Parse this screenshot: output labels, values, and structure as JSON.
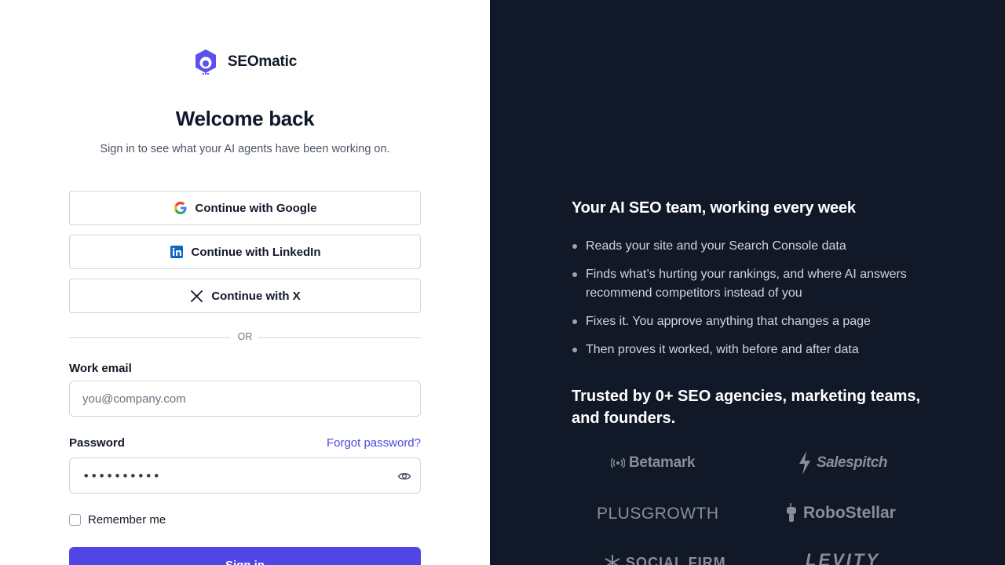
{
  "brand": {
    "name": "SEOmatic",
    "accent": "#4f46e5"
  },
  "auth": {
    "title": "Welcome back",
    "subtitle": "Sign in to see what your AI agents have been working on.",
    "oauth": {
      "google": "Continue with Google",
      "linkedin": "Continue with LinkedIn",
      "x": "Continue with X"
    },
    "divider": "OR",
    "email": {
      "label": "Work email",
      "placeholder": "you@company.com",
      "value": ""
    },
    "password": {
      "label": "Password",
      "masked_value": "••••••••••",
      "forgot": "Forgot password?"
    },
    "remember": "Remember me",
    "submit": "Sign in"
  },
  "pitch": {
    "title": "Your AI SEO team, working every week",
    "bullets": [
      "Reads your site and your Search Console data",
      "Finds what’s hurting your rankings, and where AI answers recommend competitors instead of you",
      "Fixes it. You approve anything that changes a page",
      "Then proves it worked, with before and after data"
    ],
    "trusted": "Trusted by 0+ SEO agencies, marketing teams, and founders."
  },
  "logos": [
    "Betamark",
    "Salespitch",
    "PLUSGROWTH",
    "RoboStellar",
    "SOCIAL FIRM",
    "LEVITY"
  ],
  "colors": {
    "panel_dark": "#111827",
    "button": "#4f46e5",
    "link": "#4f46e5"
  },
  "icons": {
    "logo": "robot-head-icon",
    "google": "google-icon",
    "linkedin": "linkedin-icon",
    "x": "x-icon",
    "eye": "eye-icon"
  }
}
